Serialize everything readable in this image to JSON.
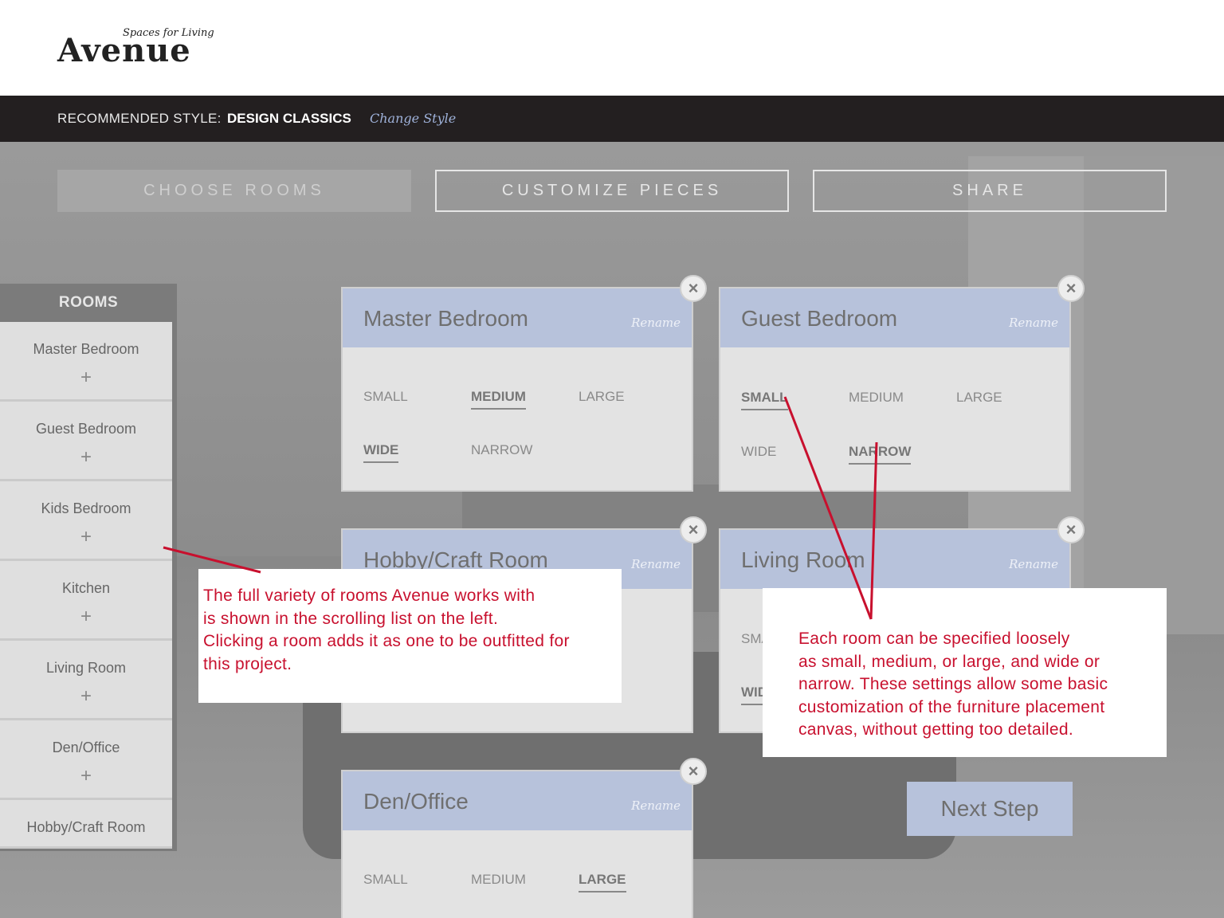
{
  "brand": {
    "tagline": "Spaces for Living",
    "name": "Avenue"
  },
  "style_bar": {
    "label": "RECOMMENDED STYLE:",
    "value": "DESIGN CLASSICS",
    "change_link": "Change Style"
  },
  "steps": [
    {
      "label": "CHOOSE ROOMS",
      "active": true
    },
    {
      "label": "CUSTOMIZE PIECES",
      "active": false
    },
    {
      "label": "SHARE",
      "active": false
    }
  ],
  "rooms_panel": {
    "title": "ROOMS",
    "plus": "+",
    "items": [
      "Master Bedroom",
      "Guest Bedroom",
      "Kids Bedroom",
      "Kitchen",
      "Living Room",
      "Den/Office",
      "Hobby/Craft Room"
    ]
  },
  "cards": [
    {
      "title": "Master Bedroom",
      "rename": "Rename",
      "close": "×",
      "size": [
        "SMALL",
        "MEDIUM",
        "LARGE"
      ],
      "width": [
        "WIDE",
        "NARROW"
      ],
      "selected_size": "MEDIUM",
      "selected_width": "WIDE"
    },
    {
      "title": "Guest Bedroom",
      "rename": "Rename",
      "close": "×",
      "size": [
        "SMALL",
        "MEDIUM",
        "LARGE"
      ],
      "width": [
        "WIDE",
        "NARROW"
      ],
      "selected_size": "SMALL",
      "selected_width": "NARROW"
    },
    {
      "title": "Hobby/Craft Room",
      "rename": "Rename",
      "close": "×"
    },
    {
      "title": "Living Room",
      "rename": "Rename",
      "close": "×",
      "size_partial": "SMA",
      "width_partial": "WID"
    },
    {
      "title": "Den/Office",
      "rename": "Rename",
      "close": "×",
      "size": [
        "SMALL",
        "MEDIUM",
        "LARGE"
      ],
      "selected_size": "LARGE"
    }
  ],
  "next_step": "Next Step",
  "annotations": [
    {
      "lines": [
        "The full variety of rooms Avenue works with",
        "is shown in the scrolling list on the left.",
        "Clicking a room adds it as one to be outfitted for",
        "this project."
      ]
    },
    {
      "lines": [
        "Each room can be specified loosely",
        "as small, medium, or large, and wide or",
        "narrow. These settings allow some basic",
        "customization of the furniture placement",
        "canvas, without getting too detailed."
      ]
    }
  ],
  "colors": {
    "accent_card": "#b7c2db",
    "annotation_text": "#c8102e",
    "style_bar_bg": "#231f20",
    "link": "#9fb2da"
  }
}
